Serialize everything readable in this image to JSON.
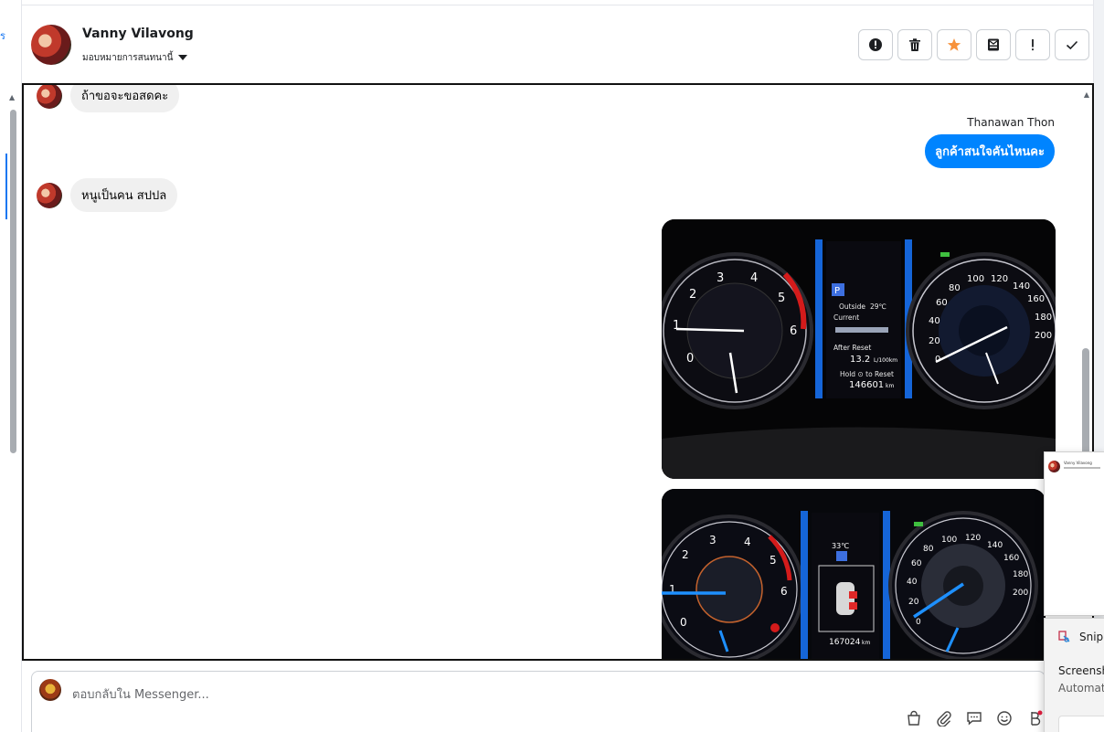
{
  "left_strip": {
    "fragment": "ร"
  },
  "header": {
    "name": "Vanny Vilavong",
    "assign_label": "มอบหมายการสนทนานี้",
    "actions": [
      {
        "icon": "alert-circle-icon"
      },
      {
        "icon": "trash-icon"
      },
      {
        "icon": "star-icon",
        "color": "#f7923b"
      },
      {
        "icon": "mark-unread-icon"
      },
      {
        "icon": "exclamation-icon"
      },
      {
        "icon": "checkmark-icon"
      }
    ]
  },
  "conversation": {
    "messages": [
      {
        "direction": "incoming",
        "text": "ถ้าขอจะขอสดคะ"
      },
      {
        "direction": "outgoing",
        "sender": "Thanawan Thon",
        "text": "ลูกค้าสนใจคันไหนคะ"
      },
      {
        "direction": "incoming",
        "text": "หนูเป็นคน สปปล"
      }
    ],
    "photos": [
      {
        "description": "instrument cluster 1",
        "tacho_ticks": [
          "0",
          "1",
          "2",
          "3",
          "4",
          "5",
          "6"
        ],
        "speedo_ticks": [
          "0",
          "20",
          "40",
          "60",
          "80",
          "100",
          "120",
          "140",
          "160",
          "180",
          "200"
        ],
        "display": {
          "outside": "Outside",
          "temp": "29℃",
          "current": "Current",
          "after_reset": "After Reset",
          "consumption": "13.2",
          "unit": "L/100km",
          "hold": "Hold ⊙ to Reset",
          "odo": "146601",
          "odo_unit": "km"
        }
      },
      {
        "description": "instrument cluster 2",
        "tacho_ticks": [
          "0",
          "1",
          "2",
          "3",
          "4",
          "5",
          "6"
        ],
        "speedo_ticks": [
          "0",
          "20",
          "40",
          "60",
          "80",
          "100",
          "120",
          "140",
          "160",
          "180",
          "200"
        ],
        "display": {
          "temp": "33℃",
          "odo": "167024",
          "odo_unit": "km"
        }
      }
    ]
  },
  "composer": {
    "placeholder": "ตอบกลับใน Messenger...",
    "tools": [
      "shopping-bag-icon",
      "paperclip-icon",
      "chat-reply-icon",
      "emoji-icon",
      "currency-icon"
    ]
  },
  "snipping_tool": {
    "app_name": "Snipp",
    "notification_title": "Screensh",
    "notification_sub": "Automat",
    "preview_name": "Vanny Vilavong"
  },
  "colors": {
    "messenger_blue": "#0084ff",
    "accent_blue": "#1877f2",
    "star_orange": "#f7923b"
  }
}
